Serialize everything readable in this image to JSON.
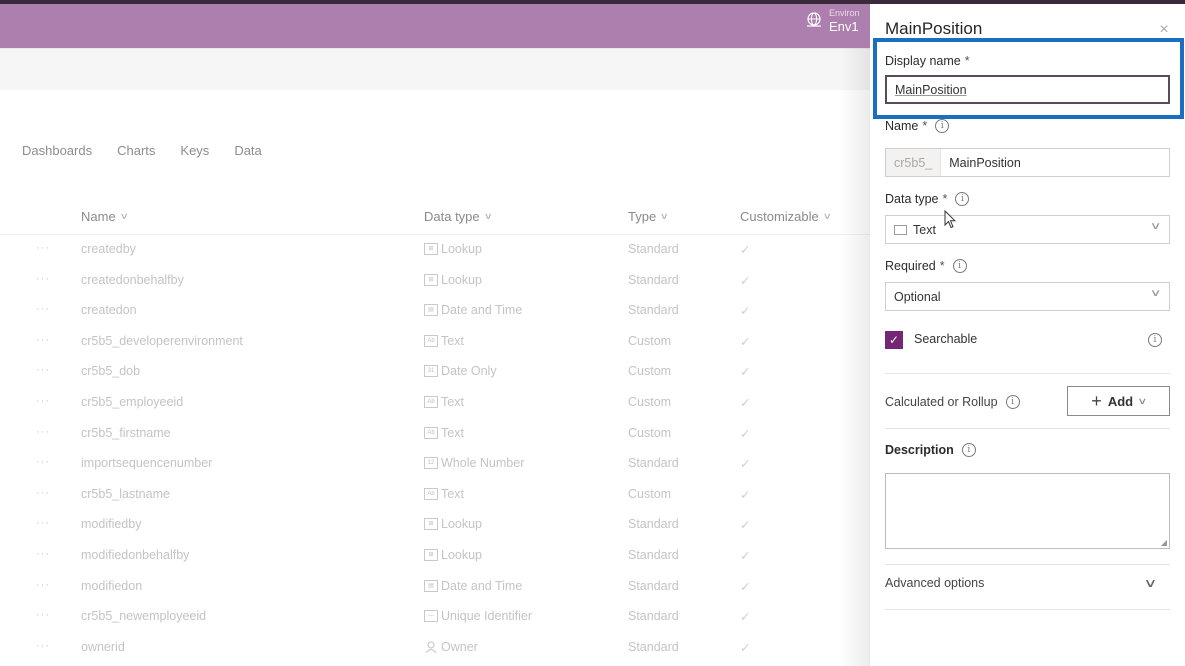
{
  "header": {
    "environment_label": "Environ",
    "environment_name": "Env1",
    "environment_icon": "globe-icon",
    "color": "#ad7fae"
  },
  "tabs": [
    {
      "label": "Dashboards"
    },
    {
      "label": "Charts"
    },
    {
      "label": "Keys"
    },
    {
      "label": "Data"
    }
  ],
  "table": {
    "columns": [
      {
        "label": "Name"
      },
      {
        "label": "Data type"
      },
      {
        "label": "Type"
      },
      {
        "label": "Customizable"
      }
    ],
    "rows": [
      {
        "more": "···",
        "name": "createdby",
        "data_type": "Lookup",
        "data_type_icon": "lookup-icon",
        "type": "Standard",
        "customizable": "✓"
      },
      {
        "more": "···",
        "name": "createdonbehalfby",
        "data_type": "Lookup",
        "data_type_icon": "lookup-icon",
        "type": "Standard",
        "customizable": "✓"
      },
      {
        "more": "···",
        "name": "createdon",
        "data_type": "Date and Time",
        "data_type_icon": "date-time-icon",
        "type": "Standard",
        "customizable": "✓"
      },
      {
        "more": "···",
        "name": "cr5b5_developerenvironment",
        "data_type": "Text",
        "data_type_icon": "text-icon",
        "type": "Custom",
        "customizable": "✓"
      },
      {
        "more": "···",
        "name": "cr5b5_dob",
        "data_type": "Date Only",
        "data_type_icon": "date-only-icon",
        "type": "Custom",
        "customizable": "✓"
      },
      {
        "more": "···",
        "name": "cr5b5_employeeid",
        "data_type": "Text",
        "data_type_icon": "text-icon",
        "type": "Custom",
        "customizable": "✓"
      },
      {
        "more": "···",
        "name": "cr5b5_firstname",
        "data_type": "Text",
        "data_type_icon": "text-icon",
        "type": "Custom",
        "customizable": "✓"
      },
      {
        "more": "···",
        "name": "importsequencenumber",
        "data_type": "Whole Number",
        "data_type_icon": "whole-number-icon",
        "type": "Standard",
        "customizable": "✓"
      },
      {
        "more": "···",
        "name": "cr5b5_lastname",
        "data_type": "Text",
        "data_type_icon": "text-icon",
        "type": "Custom",
        "customizable": "✓"
      },
      {
        "more": "···",
        "name": "modifiedby",
        "data_type": "Lookup",
        "data_type_icon": "lookup-icon",
        "type": "Standard",
        "customizable": "✓"
      },
      {
        "more": "···",
        "name": "modifiedonbehalfby",
        "data_type": "Lookup",
        "data_type_icon": "lookup-icon",
        "type": "Standard",
        "customizable": "✓"
      },
      {
        "more": "···",
        "name": "modifiedon",
        "data_type": "Date and Time",
        "data_type_icon": "date-time-icon",
        "type": "Standard",
        "customizable": "✓"
      },
      {
        "more": "···",
        "name": "cr5b5_newemployeeid",
        "data_type": "Unique Identifier",
        "data_type_icon": "unique-identifier-icon",
        "type": "Standard",
        "customizable": "✓"
      },
      {
        "more": "···",
        "name": "ownerid",
        "data_type": "Owner",
        "data_type_icon": "owner-icon",
        "type": "Standard",
        "customizable": "✓"
      }
    ]
  },
  "panel": {
    "title": "MainPosition",
    "close_icon": "×",
    "display_name": {
      "label": "Display name",
      "required": "*",
      "value": "MainPosition"
    },
    "name": {
      "label": "Name",
      "required": "*",
      "prefix": "cr5b5_",
      "value": "MainPosition"
    },
    "data_type": {
      "label": "Data type",
      "required": "*",
      "value": "Text"
    },
    "required": {
      "label": "Required",
      "required": "*",
      "value": "Optional"
    },
    "searchable": {
      "label": "Searchable",
      "checked": true,
      "check_glyph": "✓"
    },
    "calculated": {
      "label": "Calculated or Rollup",
      "button_label": "Add",
      "plus": "+"
    },
    "description": {
      "label": "Description",
      "value": ""
    },
    "advanced": {
      "label": "Advanced options"
    },
    "info_glyph": "i",
    "chevron": "∨",
    "accent_color": "#742774",
    "highlight_color": "#1a6fc0"
  }
}
